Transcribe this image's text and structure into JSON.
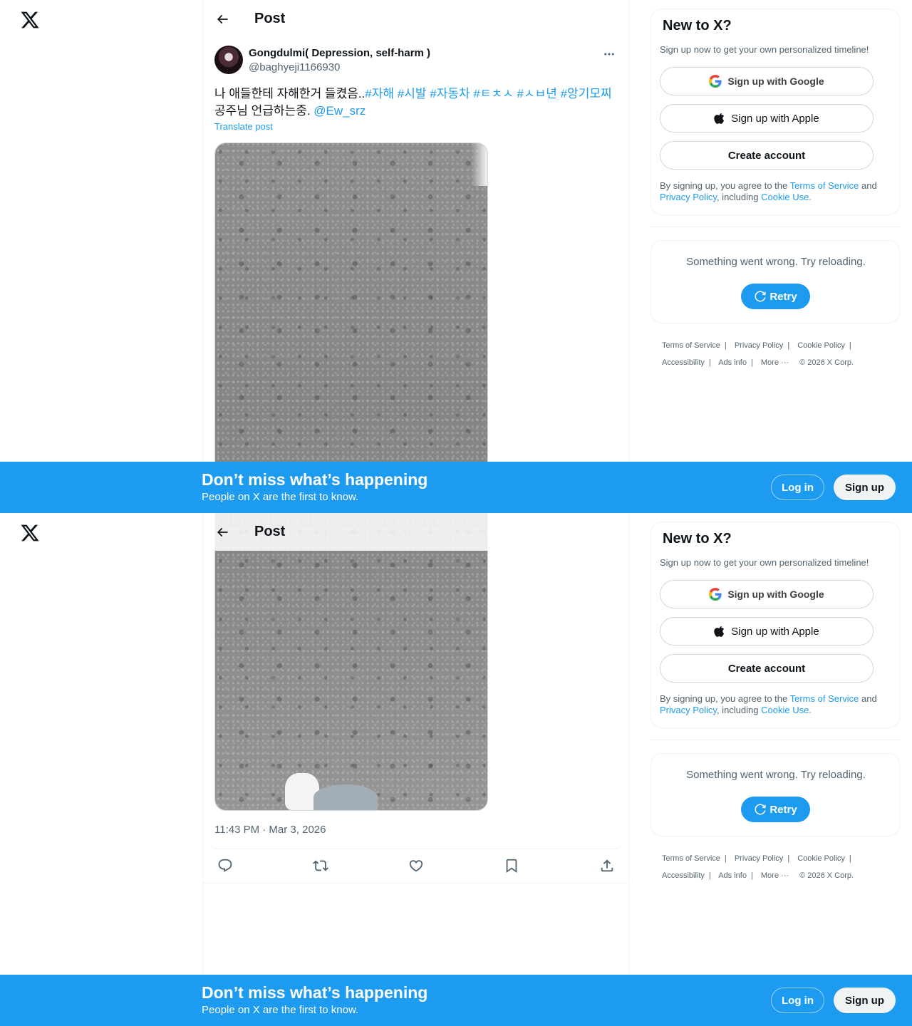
{
  "header": {
    "title": "Post"
  },
  "post": {
    "display_name": "Gongdulmi( Depression, self-harm )",
    "handle": "@baghyeji1166930",
    "text_plain_1": "나 애들한테 자해한거 들켰음..",
    "hashtags": [
      "#자해",
      "#시발",
      "#자동차",
      "#ㅌㅊㅅ",
      "#ㅅㅂ년",
      "#앙기모찌"
    ],
    "text_plain_2": " 공주님 언급하는중. ",
    "mention": "@Ew_srz",
    "translate": "Translate post",
    "timestamp": "11:43 PM · Mar 3, 2026"
  },
  "icons": {
    "logo": "x-logo-icon",
    "back": "arrow-left-icon",
    "more": "more-horizontal-icon",
    "reply": "reply-icon",
    "repost": "repost-icon",
    "like": "heart-icon",
    "bookmark": "bookmark-icon",
    "share": "share-icon"
  },
  "signup": {
    "title": "New to X?",
    "subtitle": "Sign up now to get your own personalized timeline!",
    "google_label": "Sign up with Google",
    "apple_label": "Sign up with Apple",
    "create_label": "Create account",
    "legal_prefix": "By signing up, you agree to the ",
    "terms": "Terms of Service",
    "and": " and ",
    "privacy": "Privacy Policy",
    "including": ", including ",
    "cookie": "Cookie Use."
  },
  "error": {
    "message": "Something went wrong. Try reloading.",
    "retry_label": "Retry"
  },
  "footer": {
    "links": [
      "Terms of Service",
      "Privacy Policy",
      "Cookie Policy",
      "Accessibility",
      "Ads info",
      "More ···"
    ],
    "copyright": "© 2026 X Corp."
  },
  "banner": {
    "title": "Don’t miss what’s happening",
    "subtitle": "People on X are the first to know.",
    "login_label": "Log in",
    "signup_label": "Sign up"
  },
  "colors": {
    "accent": "#1d9bf0",
    "text": "#0f1419",
    "muted": "#536471",
    "border": "#eff3f4"
  }
}
